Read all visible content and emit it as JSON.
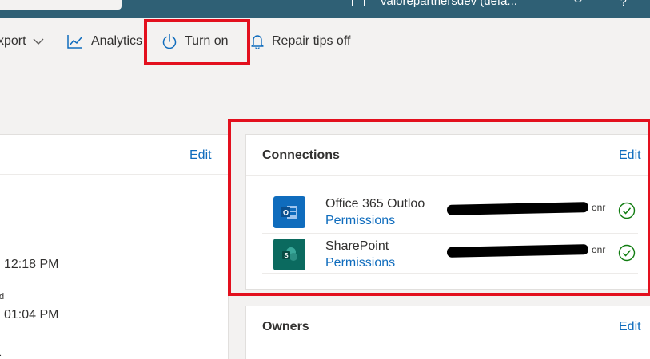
{
  "topbar": {
    "env_label": "valorepartnersdev (defa..."
  },
  "commandbar": {
    "export_label": "xport",
    "analytics_label": "Analytics",
    "turnon_label": "Turn on",
    "repair_label": "Repair tips off"
  },
  "details": {
    "edit_label": "Edit",
    "modified_time": "12:18 PM",
    "created_time": "01:04 PM",
    "fragment_1": "d",
    "fragment_2": "."
  },
  "connections": {
    "title": "Connections",
    "edit_label": "Edit",
    "items": [
      {
        "name": "Office 365 Outloo",
        "permissions_label": "Permissions",
        "account_tail": "onr",
        "status": "connected",
        "icon": "outlook-icon",
        "color": "#0f6cbd"
      },
      {
        "name": "SharePoint",
        "permissions_label": "Permissions",
        "account_tail": "onr",
        "status": "connected",
        "icon": "sharepoint-icon",
        "color": "#0b6a5f"
      }
    ]
  },
  "owners": {
    "title": "Owners",
    "edit_label": "Edit"
  },
  "colors": {
    "accent": "#0f6cbd",
    "highlight": "#e3101e",
    "topbar": "#2f6075",
    "success": "#107c10"
  }
}
